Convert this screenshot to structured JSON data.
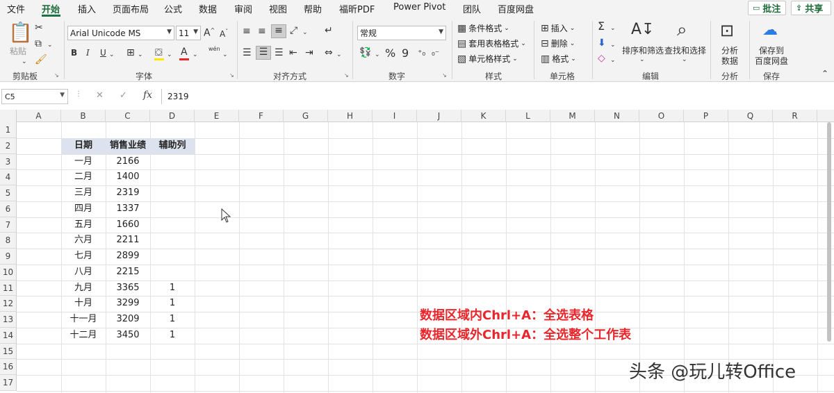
{
  "menu": {
    "tabs": [
      "文件",
      "开始",
      "插入",
      "页面布局",
      "公式",
      "数据",
      "审阅",
      "视图",
      "帮助",
      "福昕PDF",
      "Power Pivot",
      "团队",
      "百度网盘"
    ],
    "active_tab": "开始",
    "comment_label": "批注",
    "share_label": "共享"
  },
  "ribbon": {
    "clipboard": {
      "paste": "粘贴",
      "group": "剪贴板"
    },
    "font": {
      "name": "Arial Unicode MS",
      "size": "11",
      "bold": "B",
      "italic": "I",
      "underline": "U",
      "grow": "A",
      "shrink": "A",
      "phonetic": "wén",
      "group": "字体"
    },
    "alignment": {
      "group": "对齐方式"
    },
    "number": {
      "format": "常规",
      "percent": "%",
      "comma": "9",
      "group": "数字"
    },
    "styles": {
      "conditional": "条件格式",
      "table": "套用表格格式",
      "cell": "单元格样式",
      "group": "样式"
    },
    "cells": {
      "insert": "插入",
      "delete": "删除",
      "format": "格式",
      "group": "单元格"
    },
    "editing": {
      "sort": "排序和筛选",
      "find": "查找和选择",
      "group": "编辑"
    },
    "analysis": {
      "analyze_line1": "分析",
      "analyze_line2": "数据",
      "group": "分析"
    },
    "save": {
      "line1": "保存到",
      "line2": "百度网盘",
      "group": "保存"
    }
  },
  "formula_bar": {
    "name_box": "C5",
    "value": "2319",
    "cancel": "✕",
    "enter": "✓",
    "fx": "fx"
  },
  "sheet": {
    "columns": [
      "A",
      "B",
      "C",
      "D",
      "E",
      "F",
      "G",
      "H",
      "I",
      "J",
      "K",
      "L",
      "M",
      "N",
      "O",
      "P",
      "Q",
      "R"
    ],
    "rows": [
      "1",
      "2",
      "3",
      "4",
      "5",
      "6",
      "7",
      "8",
      "9",
      "10",
      "11",
      "12",
      "13",
      "14",
      "15",
      "16",
      "17"
    ],
    "table_headers": [
      "日期",
      "销售业绩",
      "辅助列"
    ],
    "table_rows": [
      [
        "一月",
        "2166",
        ""
      ],
      [
        "二月",
        "1400",
        ""
      ],
      [
        "三月",
        "2319",
        ""
      ],
      [
        "四月",
        "1337",
        ""
      ],
      [
        "五月",
        "1660",
        ""
      ],
      [
        "六月",
        "2211",
        ""
      ],
      [
        "七月",
        "2899",
        ""
      ],
      [
        "八月",
        "2215",
        ""
      ],
      [
        "九月",
        "3365",
        "1"
      ],
      [
        "十月",
        "3299",
        "1"
      ],
      [
        "十一月",
        "3209",
        "1"
      ],
      [
        "十二月",
        "3450",
        "1"
      ]
    ]
  },
  "notes": {
    "line1": "数据区域内Chrl+A：全选表格",
    "line2": "数据区域外Chrl+A：全选整个工作表"
  },
  "watermark": "头条 @玩儿转Office",
  "colors": {
    "accent": "#1e7145",
    "note": "#e8262b",
    "table_header_bg": "#dde3ee"
  }
}
